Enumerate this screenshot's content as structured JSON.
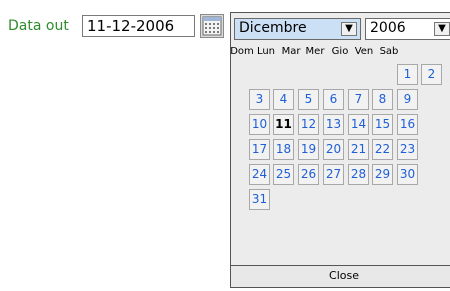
{
  "form": {
    "label": "Data out",
    "date_value": "11-12-2006",
    "calendar_icon": "calendar-icon"
  },
  "calendar": {
    "month": "Dicembre",
    "year": "2006",
    "dropdown_arrow": "▼",
    "weekdays": [
      "Dom",
      "Lun",
      "Mar",
      "Mer",
      "Gio",
      "Ven",
      "Sab"
    ],
    "selected_day": "11",
    "days": [
      "1",
      "2",
      "3",
      "4",
      "5",
      "6",
      "7",
      "8",
      "9",
      "10",
      "11",
      "12",
      "13",
      "14",
      "15",
      "16",
      "17",
      "18",
      "19",
      "20",
      "21",
      "22",
      "23",
      "24",
      "25",
      "26",
      "27",
      "28",
      "29",
      "30",
      "31"
    ],
    "close_label": "Close"
  }
}
